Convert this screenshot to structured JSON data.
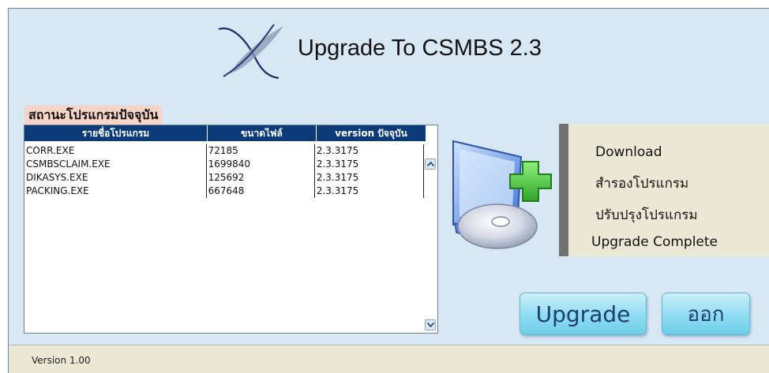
{
  "header": {
    "title": "Upgrade To CSMBS 2.3"
  },
  "status_section": {
    "title": "สถานะโปรแกรมปัจจุบัน",
    "columns": [
      "รายชื่อโปรแกรม",
      "ขนาดไฟล์",
      "version ปัจจุบัน"
    ],
    "rows": [
      [
        "CORR.EXE",
        "72185",
        "2.3.3175"
      ],
      [
        "CSMBSCLAIM.EXE",
        "1699840",
        "2.3.3175"
      ],
      [
        "DIKASYS.EXE",
        "125692",
        "2.3.3175"
      ],
      [
        "PACKING.EXE",
        "667648",
        "2.3.3175"
      ]
    ]
  },
  "steps": [
    "Download",
    "สำรองโปรแกรม",
    "ปรับปรุงโปรแกรม",
    "Upgrade Complete"
  ],
  "buttons": {
    "upgrade": "Upgrade",
    "exit": "ออก"
  },
  "footer": {
    "version": "Version   1.00"
  },
  "colors": {
    "window_bg": "#d7e7f4",
    "header_bg": "#0a3a78",
    "section_label_bg": "#f6d4c6",
    "panel_bg": "#ece8d6",
    "button": "#8fdcf1",
    "button_text": "#1f3d72"
  },
  "icons": [
    "csmbs-logo-icon",
    "computer-disc-plus-icon",
    "scroll-up-icon",
    "scroll-down-icon"
  ]
}
